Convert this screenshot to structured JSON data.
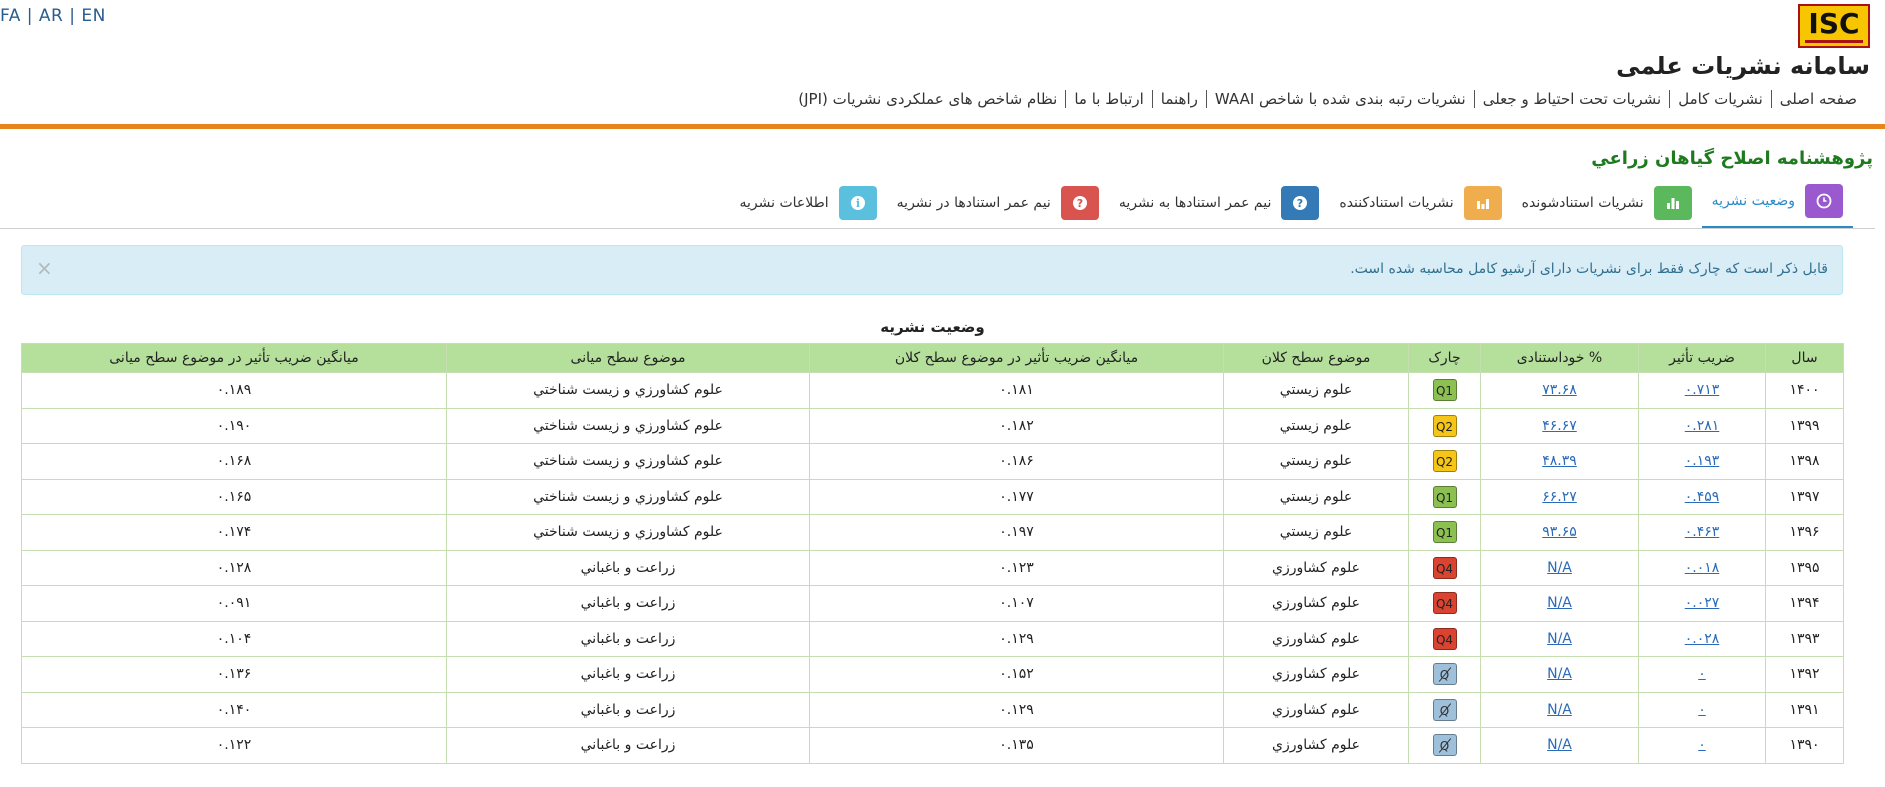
{
  "header": {
    "languages": [
      "FA",
      "AR",
      "EN"
    ],
    "logo_text": "ISC",
    "site_title": "سامانه نشریات علمی",
    "nav": [
      "صفحه اصلی",
      "نشریات کامل",
      "نشریات تحت احتیاط و جعلی",
      "نشریات رتبه بندی شده با شاخص WAAI",
      "راهنما",
      "ارتباط با ما",
      "نظام شاخص های عملکردی نشریات (JPI)"
    ]
  },
  "journal": {
    "title": "پژوهشنامه اصلاح گیاهان زراعي"
  },
  "tabs": [
    {
      "label": "وضعیت نشریه",
      "icon": "clock-icon",
      "color": "#9b59d0",
      "active": true
    },
    {
      "label": "نشریات استنادشونده",
      "icon": "bar-chart-icon",
      "color": "#5cb85c",
      "active": false
    },
    {
      "label": "نشریات استنادکننده",
      "icon": "bar-chart-icon",
      "color": "#f0ad4e",
      "active": false
    },
    {
      "label": "نیم عمر استنادها به نشریه",
      "icon": "question-icon",
      "color": "#337ab7",
      "active": false
    },
    {
      "label": "نیم عمر استنادها در نشریه",
      "icon": "question-icon",
      "color": "#d9534f",
      "active": false
    },
    {
      "label": "اطلاعات نشریه",
      "icon": "info-icon",
      "color": "#5bc0de",
      "active": false
    }
  ],
  "alert": {
    "text": "قابل ذکر است که چارک فقط برای نشریات دارای آرشیو کامل محاسبه شده است.",
    "close": "×"
  },
  "table": {
    "caption": "وضعیت نشریه",
    "headers": [
      "سال",
      "ضریب تأثیر",
      "% خوداستنادی",
      "چارک",
      "موضوع سطح کلان",
      "میانگین ضریب تأثیر در موضوع سطح کلان",
      "موضوع سطح میانی",
      "میانگین ضریب تأثیر در موضوع سطح میانی"
    ],
    "rows": [
      {
        "year": "۱۴۰۰",
        "if": "۰.۷۱۳",
        "self": "۷۳.۶۸",
        "q": "Q1",
        "macro": "علوم زيستي",
        "macro_avg": "۰.۱۸۱",
        "mid": "علوم كشاورزي و زيست شناختي",
        "mid_avg": "۰.۱۸۹"
      },
      {
        "year": "۱۳۹۹",
        "if": "۰.۲۸۱",
        "self": "۴۶.۶۷",
        "q": "Q2",
        "macro": "علوم زيستي",
        "macro_avg": "۰.۱۸۲",
        "mid": "علوم كشاورزي و زيست شناختي",
        "mid_avg": "۰.۱۹۰"
      },
      {
        "year": "۱۳۹۸",
        "if": "۰.۱۹۳",
        "self": "۴۸.۳۹",
        "q": "Q2",
        "macro": "علوم زيستي",
        "macro_avg": "۰.۱۸۶",
        "mid": "علوم كشاورزي و زيست شناختي",
        "mid_avg": "۰.۱۶۸"
      },
      {
        "year": "۱۳۹۷",
        "if": "۰.۴۵۹",
        "self": "۶۶.۲۷",
        "q": "Q1",
        "macro": "علوم زيستي",
        "macro_avg": "۰.۱۷۷",
        "mid": "علوم كشاورزي و زيست شناختي",
        "mid_avg": "۰.۱۶۵"
      },
      {
        "year": "۱۳۹۶",
        "if": "۰.۴۶۳",
        "self": "۹۳.۶۵",
        "q": "Q1",
        "macro": "علوم زيستي",
        "macro_avg": "۰.۱۹۷",
        "mid": "علوم كشاورزي و زيست شناختي",
        "mid_avg": "۰.۱۷۴"
      },
      {
        "year": "۱۳۹۵",
        "if": "۰.۰۱۸",
        "self": "N/A",
        "q": "Q4",
        "macro": "علوم كشاورزي",
        "macro_avg": "۰.۱۲۳",
        "mid": "زراعت و باغباني",
        "mid_avg": "۰.۱۲۸"
      },
      {
        "year": "۱۳۹۴",
        "if": "۰.۰۲۷",
        "self": "N/A",
        "q": "Q4",
        "macro": "علوم كشاورزي",
        "macro_avg": "۰.۱۰۷",
        "mid": "زراعت و باغباني",
        "mid_avg": "۰.۰۹۱"
      },
      {
        "year": "۱۳۹۳",
        "if": "۰.۰۲۸",
        "self": "N/A",
        "q": "Q4",
        "macro": "علوم كشاورزي",
        "macro_avg": "۰.۱۲۹",
        "mid": "زراعت و باغباني",
        "mid_avg": "۰.۱۰۴"
      },
      {
        "year": "۱۳۹۲",
        "if": "۰",
        "self": "N/A",
        "q": "none",
        "macro": "علوم كشاورزي",
        "macro_avg": "۰.۱۵۲",
        "mid": "زراعت و باغباني",
        "mid_avg": "۰.۱۳۶"
      },
      {
        "year": "۱۳۹۱",
        "if": "۰",
        "self": "N/A",
        "q": "none",
        "macro": "علوم كشاورزي",
        "macro_avg": "۰.۱۲۹",
        "mid": "زراعت و باغباني",
        "mid_avg": "۰.۱۴۰"
      },
      {
        "year": "۱۳۹۰",
        "if": "۰",
        "self": "N/A",
        "q": "none",
        "macro": "علوم كشاورزي",
        "macro_avg": "۰.۱۳۵",
        "mid": "زراعت و باغباني",
        "mid_avg": "۰.۱۲۲"
      }
    ]
  },
  "colors": {
    "q1": "#8cc152",
    "q2": "#f5c518",
    "q4": "#d9432f",
    "q_none": "#9fc0da",
    "header_green": "#b5e09b",
    "accent_orange": "#e8851a",
    "journal_green": "#1f7a1f"
  }
}
